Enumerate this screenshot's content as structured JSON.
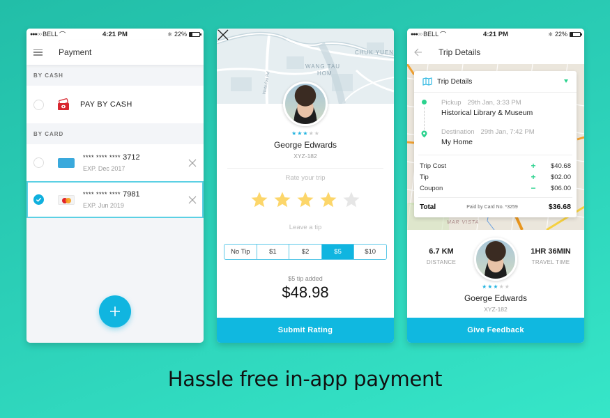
{
  "status_bar": {
    "carrier": "BELL",
    "time": "4:21 PM",
    "battery": "22%"
  },
  "payment_screen": {
    "title": "Payment",
    "cash_section_label": "BY CASH",
    "cash_option_label": "PAY BY CASH",
    "card_section_label": "BY CARD",
    "cards": [
      {
        "masked": "**** **** ****",
        "last4": "3712",
        "expiry": "EXP. Dec 2017",
        "brand": "amex",
        "selected": false
      },
      {
        "masked": "**** **** ****",
        "last4": "7981",
        "expiry": "EXP. Jun 2019",
        "brand": "mastercard",
        "selected": true
      }
    ],
    "add_button_symbol": "+"
  },
  "rating_screen": {
    "map_labels": [
      "WANG TAU",
      "HOM",
      "CHUK YUEN",
      "Waterloo Rd"
    ],
    "driver_name": "George Edwards",
    "plate": "XYZ-182",
    "driver_rating": 3,
    "rate_label": "Rate your trip",
    "user_rating": 4,
    "max_rating": 5,
    "tip_label": "Leave a tip",
    "tip_options": [
      "No Tip",
      "$1",
      "$2",
      "$5",
      "$10"
    ],
    "selected_tip": "$5",
    "tip_added_text": "$5 tip added",
    "total": "$48.98",
    "submit_label": "Submit Rating"
  },
  "trip_screen": {
    "title": "Trip Details",
    "card_title": "Trip Details",
    "pickup": {
      "label": "Pickup",
      "time": "29th Jan, 3:33 PM",
      "place": "Historical Library & Museum"
    },
    "destination": {
      "label": "Destination",
      "time": "29th Jan, 7:42 PM",
      "place": "My Home"
    },
    "fees": [
      {
        "label": "Trip Cost",
        "sign": "+",
        "value": "$40.68"
      },
      {
        "label": "Tip",
        "sign": "+",
        "value": "$02.00"
      },
      {
        "label": "Coupon",
        "sign": "−",
        "value": "$06.00"
      }
    ],
    "total_label": "Total",
    "paid_by": "Paid by Card No. *3259",
    "total_value": "$36.68",
    "map_label": "MAR VISTA",
    "distance_value": "6.7 KM",
    "distance_label": "DISTANCE",
    "time_value": "1HR 36MIN",
    "time_label": "TRAVEL TIME",
    "driver_name": "Goerge Edwards",
    "plate": "XYZ-182",
    "driver_rating": 3,
    "feedback_label": "Give Feedback"
  },
  "tagline": "Hassle free in-app payment",
  "colors": {
    "accent": "#10b5e0",
    "green": "#2bd28e",
    "star": "#fcd66a",
    "background": "#2cd0b8"
  }
}
